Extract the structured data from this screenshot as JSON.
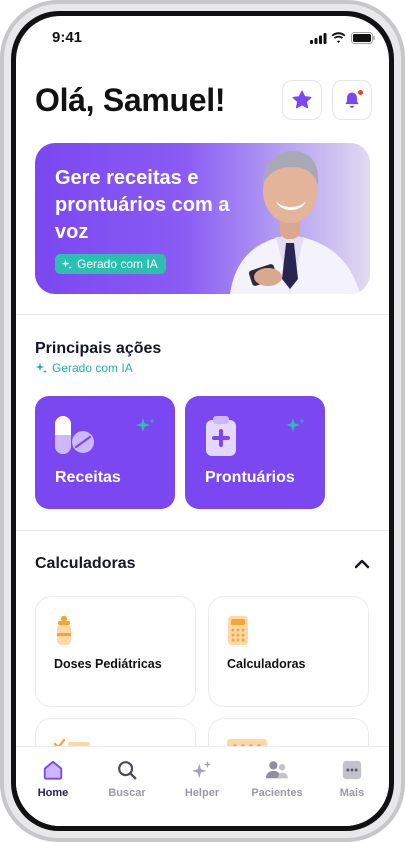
{
  "status_bar": {
    "time": "9:41"
  },
  "header": {
    "greeting": "Olá, Samuel!"
  },
  "banner": {
    "title": "Gere receitas e prontuários com a voz",
    "badge": "Gerado com IA"
  },
  "actions": {
    "title": "Principais ações",
    "subtitle": "Gerado com IA",
    "cards": [
      {
        "label": "Receitas"
      },
      {
        "label": "Prontuários"
      }
    ]
  },
  "calculators": {
    "title": "Calculadoras",
    "tiles": [
      {
        "label": "Doses Pediátricas"
      },
      {
        "label": "Calculadoras"
      }
    ]
  },
  "tabbar": {
    "items": [
      {
        "label": "Home",
        "icon": "home-icon",
        "active": true
      },
      {
        "label": "Buscar",
        "icon": "search-icon"
      },
      {
        "label": "Helper",
        "icon": "sparkles-icon"
      },
      {
        "label": "Pacientes",
        "icon": "users-icon"
      },
      {
        "label": "Mais",
        "icon": "more-icon"
      }
    ]
  },
  "colors": {
    "primary": "#7b47f0",
    "ia_accent": "#2bbfb0",
    "notification": "#ef3b3b"
  }
}
